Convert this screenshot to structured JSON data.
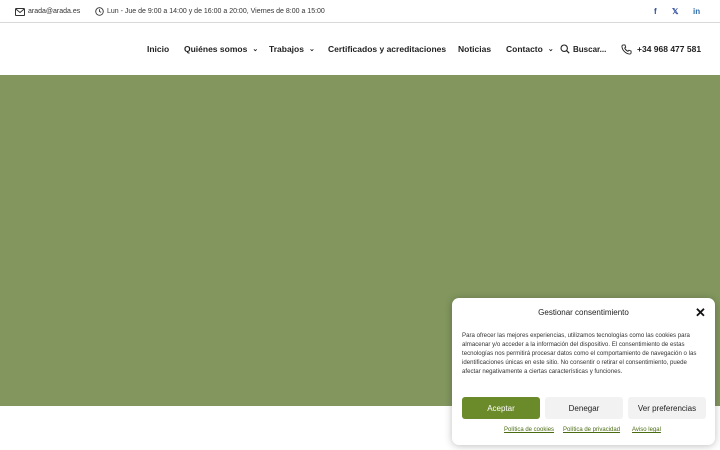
{
  "topbar": {
    "email": "arada@arada.es",
    "hours": "Lun - Jue de 9:00 a 14:00 y de 16:00 a 20:00, Viernes de 8:00 a 15:00",
    "social": {
      "facebook": "f",
      "twitter": "𝕏",
      "linkedin": "in"
    }
  },
  "nav": {
    "items": [
      {
        "label": "Inicio",
        "dropdown": false
      },
      {
        "label": "Quiénes somos",
        "dropdown": true
      },
      {
        "label": "Trabajos",
        "dropdown": true
      },
      {
        "label": "Certificados y acreditaciones",
        "dropdown": false
      },
      {
        "label": "Noticias",
        "dropdown": false
      },
      {
        "label": "Contacto",
        "dropdown": true
      }
    ],
    "search_label": "Buscar...",
    "phone": "+34 968 477 581"
  },
  "hero": {
    "color": "#82965e"
  },
  "cookie": {
    "title": "Gestionar consentimiento",
    "text": "Para ofrecer las mejores experiencias, utilizamos tecnologías como las cookies para almacenar y/o acceder a la información del dispositivo. El consentimiento de estas tecnologías nos permitirá procesar datos como el comportamiento de navegación o las identificaciones únicas en este sitio. No consentir o retirar el consentimiento, puede afectar negativamente a ciertas características y funciones.",
    "accept": "Aceptar",
    "deny": "Denegar",
    "preferences": "Ver preferencias",
    "links": [
      "Política de cookies",
      "Política de privacidad",
      "Aviso legal"
    ],
    "accent": "#6b8a2a"
  },
  "icons": {
    "mail": "mail-icon",
    "clock": "clock-icon",
    "search": "search-icon",
    "phone": "phone-icon",
    "close": "close-icon",
    "chevron": "chevron-down-icon"
  }
}
